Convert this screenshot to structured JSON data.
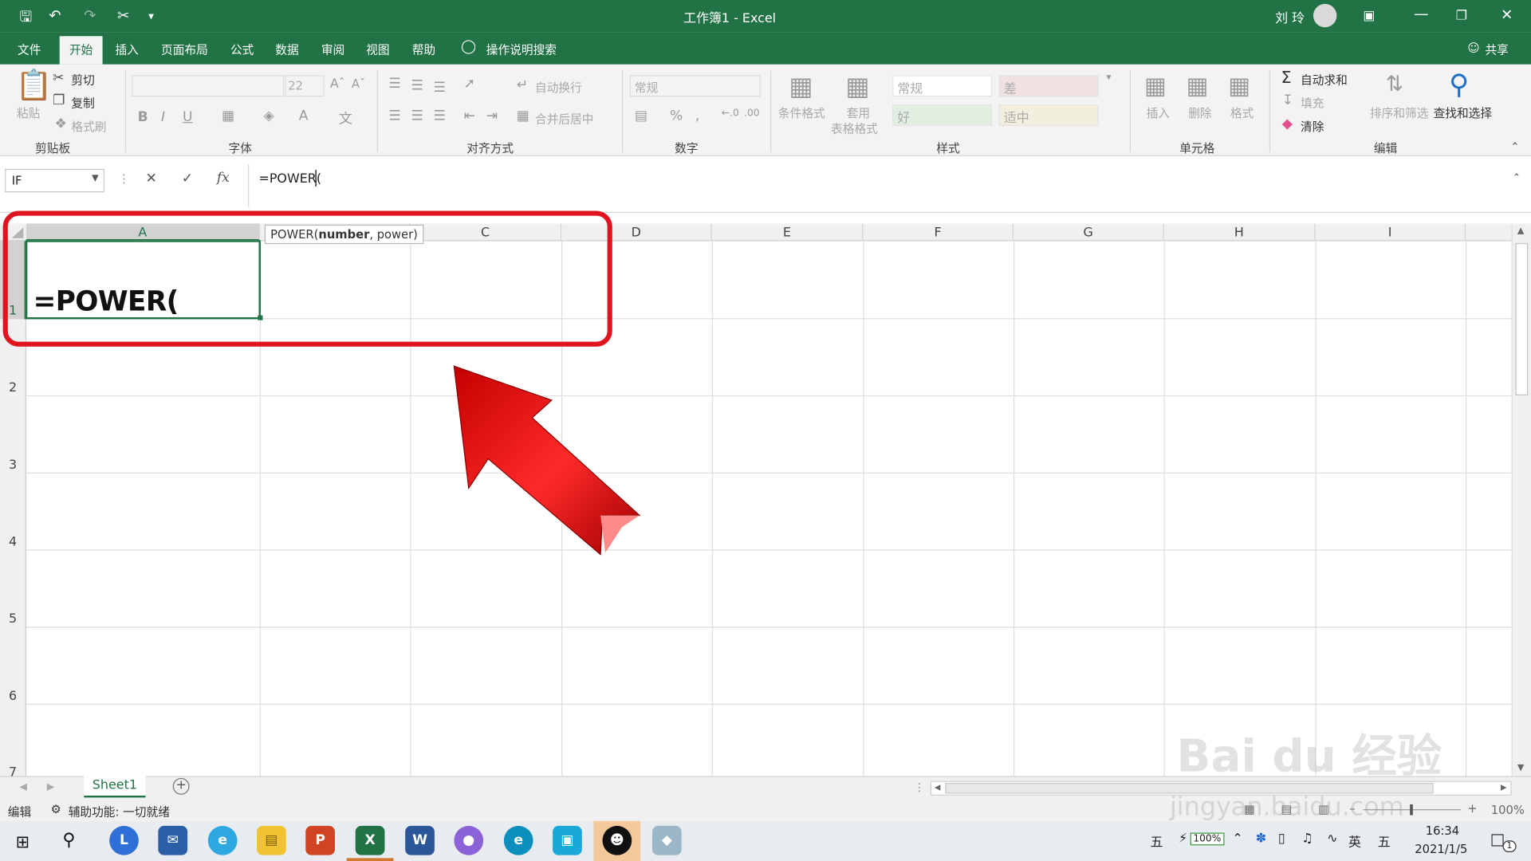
{
  "window": {
    "title": "工作簿1 - Excel",
    "user": "刘 玲"
  },
  "menu_tabs": [
    "文件",
    "开始",
    "插入",
    "页面布局",
    "公式",
    "数据",
    "审阅",
    "视图",
    "帮助"
  ],
  "tell_me": "操作说明搜索",
  "share": "共享",
  "clipboard": {
    "paste": "粘贴",
    "cut": "剪切",
    "copy": "复制",
    "format_painter": "格式刷",
    "label": "剪贴板"
  },
  "font": {
    "size": "22",
    "label": "字体",
    "bold": "B",
    "italic": "I",
    "underline": "U"
  },
  "alignment": {
    "wrap": "自动换行",
    "merge": "合并后居中",
    "label": "对齐方式"
  },
  "number": {
    "format": "常规",
    "percent": "%",
    "label": "数字"
  },
  "styles": {
    "conditional": "条件格式",
    "table_format_1": "套用",
    "table_format_2": "表格格式",
    "cells": [
      "常规",
      "差",
      "好",
      "适中"
    ],
    "label": "样式"
  },
  "cells_group": {
    "insert": "插入",
    "delete": "删除",
    "format": "格式",
    "label": "单元格"
  },
  "editing": {
    "autosum": "自动求和",
    "fill": "填充",
    "clear": "清除",
    "sort": "排序和筛选",
    "find": "查找和选择",
    "label": "编辑"
  },
  "formula_bar": {
    "name_box": "IF",
    "fx": "fx",
    "formula": "=POWER("
  },
  "tooltip": {
    "func": "POWER(",
    "arg1": "number",
    ",": ", ",
    "arg2": ", power)"
  },
  "columns": [
    "A",
    "B",
    "C",
    "D",
    "E",
    "F",
    "G",
    "H",
    "I"
  ],
  "rows": [
    "1",
    "2",
    "3",
    "4",
    "5",
    "6",
    "7"
  ],
  "cell_A1": "=POWER(",
  "sheet_tab": "Sheet1",
  "status": {
    "mode": "编辑",
    "accessibility": "辅助功能: 一切就绪",
    "zoom": "100%"
  },
  "taskbar": {
    "ime1": "五",
    "battery": "100%",
    "lang": "英",
    "ime2": "五",
    "time": "16:34",
    "date": "2021/1/5",
    "notif": "1"
  },
  "watermark": {
    "brand": "Bai du 经验",
    "url": "jingyan.baidu.com"
  },
  "colors": {
    "excel_green": "#217346",
    "highlight_red": "#e0141e"
  }
}
